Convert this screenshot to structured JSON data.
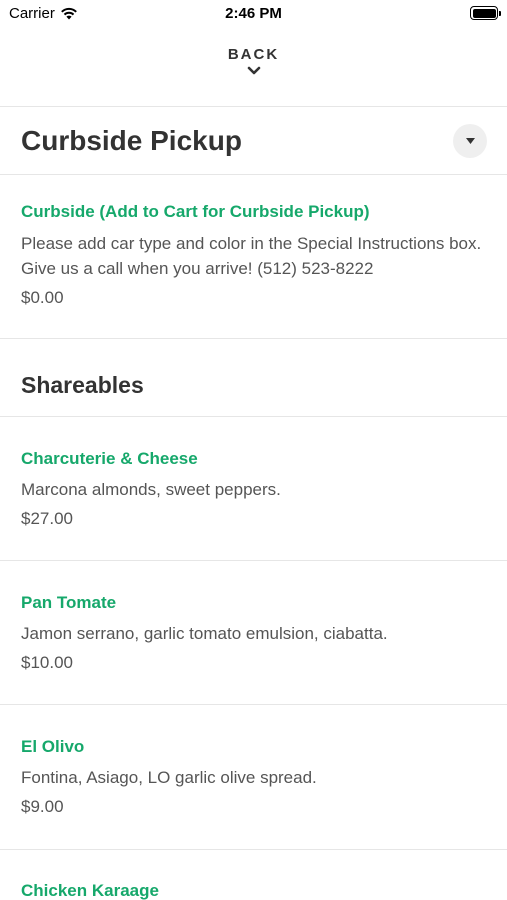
{
  "status_bar": {
    "carrier": "Carrier",
    "time": "2:46 PM"
  },
  "nav": {
    "back_label": "BACK"
  },
  "curbside_section": {
    "title": "Curbside Pickup",
    "items": [
      {
        "name": "Curbside (Add to Cart for Curbside Pickup)",
        "description": "Please add car type and color in the Special Instructions box. Give us a call when you arrive! (512) 523-8222",
        "price": "$0.00"
      }
    ]
  },
  "shareables_section": {
    "title": "Shareables",
    "items": [
      {
        "name": "Charcuterie & Cheese",
        "description": "Marcona almonds, sweet peppers.",
        "price": "$27.00"
      },
      {
        "name": "Pan Tomate",
        "description": "Jamon serrano, garlic tomato emulsion, ciabatta.",
        "price": "$10.00"
      },
      {
        "name": "El Olivo",
        "description": "Fontina, Asiago, LO garlic olive spread.",
        "price": "$9.00"
      },
      {
        "name": "Chicken Karaage"
      }
    ]
  },
  "colors": {
    "accent": "#16a86b",
    "text": "#333333",
    "muted": "#555555",
    "divider": "#e6e6e6"
  }
}
